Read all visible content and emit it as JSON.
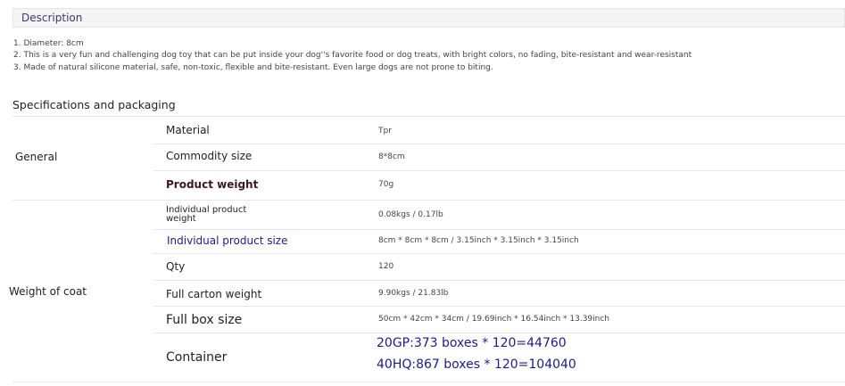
{
  "description": {
    "title": "Description",
    "items": [
      "1. Diameter: 8cm",
      "2. This is a very fun and challenging dog toy that can be put inside your dog''s favorite food or dog treats, with bright colors, no fading, bite-resistant and wear-resistant",
      "3. Made of natural silicone material, safe, non-toxic, flexible and bite-resistant. Even large dogs are not prone to biting."
    ]
  },
  "specs": {
    "title": "Specifications and packaging",
    "groups": [
      {
        "label": "General",
        "rows": [
          {
            "attr": "Material",
            "value": "Tpr"
          },
          {
            "attr": "Commodity size",
            "value": "8*8cm"
          },
          {
            "attr": "Product weight",
            "value": "70g"
          }
        ]
      },
      {
        "label": "Weight of coat",
        "rows": [
          {
            "attr": "Individual product weight",
            "value": "0.08kgs / 0.17lb"
          },
          {
            "attr": "Individual product size",
            "value": "8cm * 8cm * 8cm / 3.15inch * 3.15inch * 3.15inch"
          },
          {
            "attr": "Qty",
            "value": "120"
          },
          {
            "attr": "Full carton weight",
            "value": "9.90kgs / 21.83lb"
          },
          {
            "attr": "Full box size",
            "value": "50cm * 42cm * 34cm / 19.69inch * 16.54inch * 13.39inch"
          },
          {
            "attr": "Container",
            "value": [
              "20GP:373 boxes * 120=44760",
              "40HQ:867 boxes * 120=104040"
            ]
          }
        ]
      }
    ]
  },
  "colors": {
    "accent_navy": "#1c1c8c",
    "product_weight_label": "#3a1a1a"
  }
}
